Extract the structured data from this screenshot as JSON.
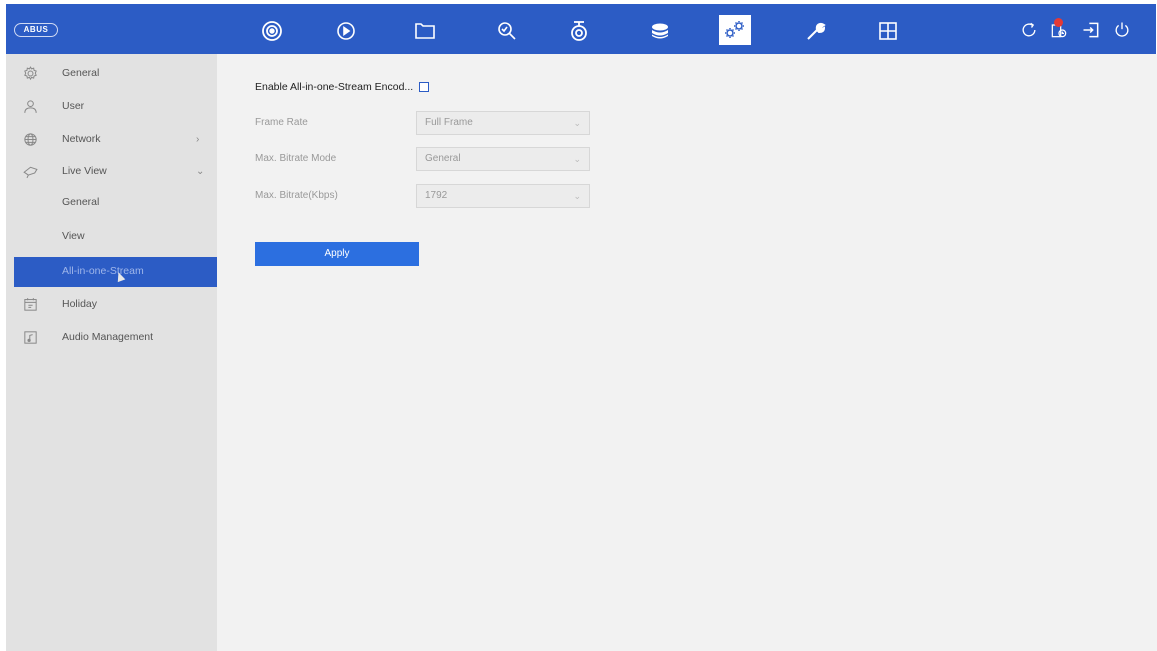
{
  "topbar": {
    "logo": "ABUS",
    "active_nav": "configuration",
    "nav": [
      {
        "id": "live-view",
        "icon": "live-view-icon"
      },
      {
        "id": "playback",
        "icon": "playback-icon"
      },
      {
        "id": "files",
        "icon": "folder-icon"
      },
      {
        "id": "search",
        "icon": "search-icon"
      },
      {
        "id": "camera",
        "icon": "camera-icon"
      },
      {
        "id": "storage",
        "icon": "storage-icon"
      },
      {
        "id": "configuration",
        "icon": "gears-icon"
      },
      {
        "id": "maintenance",
        "icon": "wrench-icon"
      },
      {
        "id": "layout",
        "icon": "grid-icon"
      }
    ],
    "right": [
      {
        "id": "refresh",
        "icon": "refresh-icon"
      },
      {
        "id": "alarm",
        "icon": "alarm-icon"
      },
      {
        "id": "logout",
        "icon": "logout-icon"
      },
      {
        "id": "power",
        "icon": "power-icon"
      }
    ],
    "accent_color": "#2c5cc5"
  },
  "sidebar": {
    "items": [
      {
        "label": "General",
        "icon": "gear-outline-icon"
      },
      {
        "label": "User",
        "icon": "user-icon"
      },
      {
        "label": "Network",
        "icon": "globe-icon",
        "chevron": ">"
      },
      {
        "label": "Live View",
        "icon": "live-view-outline-icon",
        "chevron": "v"
      },
      {
        "label": "Holiday",
        "icon": "calendar-icon"
      },
      {
        "label": "Audio Management",
        "icon": "audio-file-icon"
      }
    ],
    "subitems": [
      {
        "label": "General"
      },
      {
        "label": "View"
      },
      {
        "label": "All-in-one-Stream",
        "active": true
      }
    ]
  },
  "form": {
    "enable_label": "Enable All-in-one-Stream Encod...",
    "enable_checked": false,
    "fields": [
      {
        "label": "Frame Rate",
        "value": "Full Frame"
      },
      {
        "label": "Max. Bitrate Mode",
        "value": "General"
      },
      {
        "label": "Max. Bitrate(Kbps)",
        "value": "1792"
      }
    ],
    "apply_label": "Apply"
  }
}
